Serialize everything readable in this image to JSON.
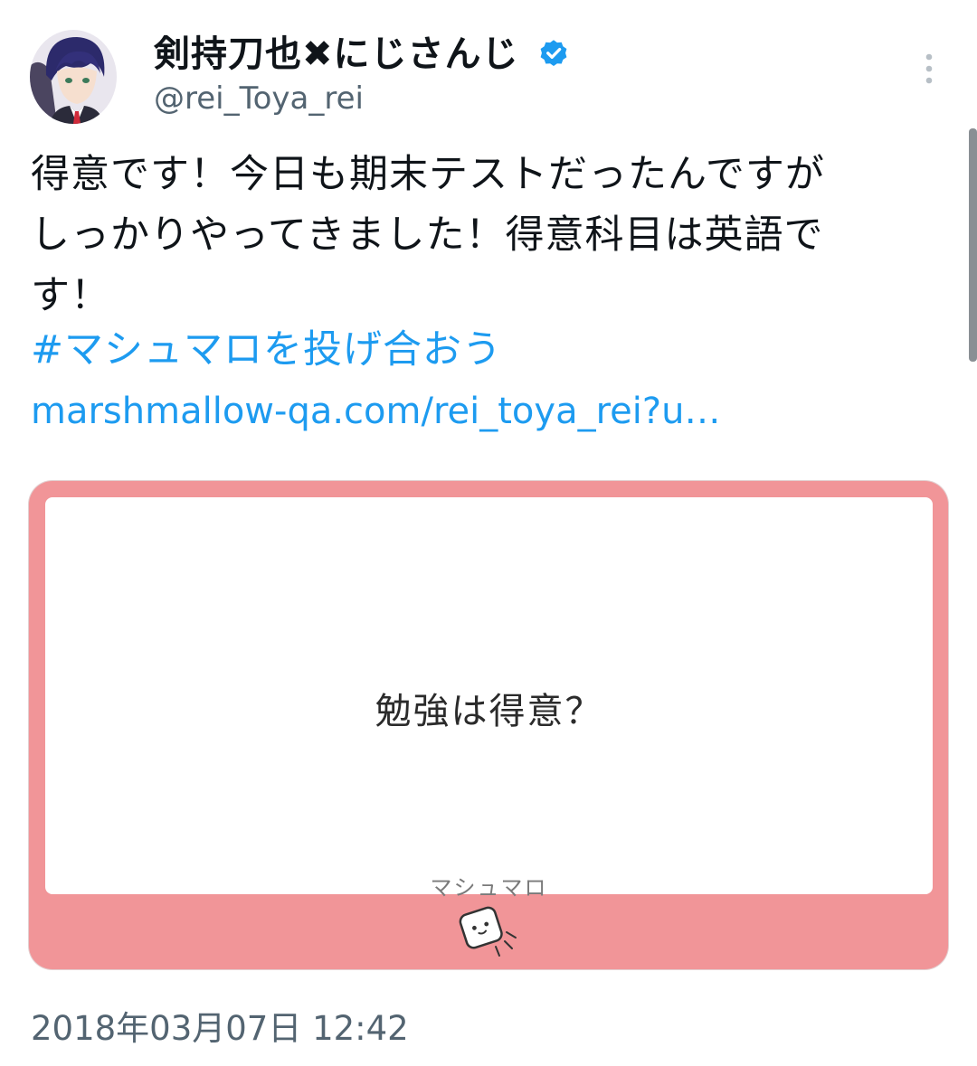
{
  "header": {
    "display_name": "剣持刀也✖にじさんじ",
    "handle": "@rei_Toya_rei"
  },
  "tweet": {
    "text_line1": "得意です！今日も期末テストだったんですが",
    "text_line2": "しっかりやってきました！得意科目は英語で",
    "text_line3": "す！",
    "hashtag": "#マシュマロを投げ合おう",
    "link": "marshmallow-qa.com/rei_toya_rei?u…"
  },
  "card": {
    "question": "勉強は得意？",
    "brand": "マシュマロ"
  },
  "timestamp": "2018年03月07日 12:42",
  "colors": {
    "link": "#1d9bf0",
    "verified": "#1d9bf0",
    "card_background": "#f19598",
    "secondary_text": "#536471"
  },
  "icons": {
    "verified": "verified-badge-icon",
    "more": "more-options-icon",
    "mascot": "marshmallow-mascot-icon"
  }
}
